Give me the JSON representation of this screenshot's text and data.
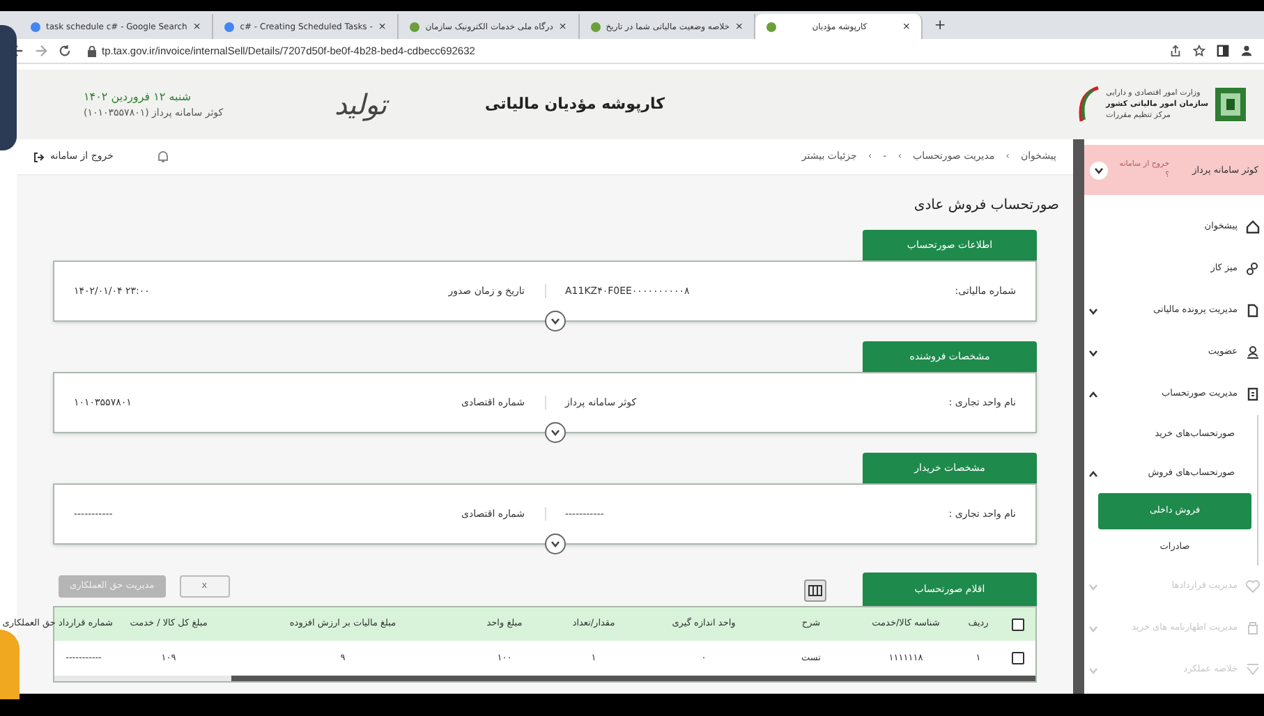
{
  "browser": {
    "tabs": [
      {
        "title": "کارپوشه مؤدیان",
        "close": "×",
        "selected": true
      },
      {
        "title": "خلاصه وضعیت مالیاتی شما در تاریخ",
        "close": "×",
        "selected": false
      },
      {
        "title": "درگاه ملی خدمات الکترونیک سازمان",
        "close": "×",
        "selected": false
      },
      {
        "title": "c# - Creating Scheduled Tasks -",
        "close": "×",
        "selected": false
      },
      {
        "title": "task schedule c# - Google Search",
        "close": "×",
        "selected": false
      }
    ],
    "new_tab": "+",
    "url": "tp.tax.gov.ir/invoice/internalSell/Details/7207d50f-be0f-4b28-bed4-cdbecc692632"
  },
  "header": {
    "date": "شنبه ۱۲ فروردین ۱۴۰۲",
    "user": "کوثر سامانه پرداز (۱۰۱۰۳۵۵۷۸۰۱)",
    "emblem_text": "تولید",
    "title": "کارپوشه مؤدیان مالیاتی",
    "org_lines": [
      "وزارت امور اقتصادی و دارایی",
      "سازمان امور مالیاتی کشور",
      "مرکز تنظیم مقررات"
    ]
  },
  "topbar": {
    "logout": "خروج از سامانه",
    "breadcrumb": [
      {
        "kind": "link",
        "text": "پیشخوان"
      },
      {
        "kind": "separator",
        "text": "›"
      },
      {
        "kind": "link",
        "text": "مدیریت صورتحساب"
      },
      {
        "kind": "separator",
        "text": "›"
      },
      {
        "kind": "link",
        "text": "-"
      },
      {
        "kind": "separator",
        "text": "›"
      },
      {
        "kind": "link",
        "text": "جزئیات بیشتر"
      }
    ]
  },
  "page_title": "صورتحساب فروش عادی",
  "sections": [
    {
      "title": "اطلاعات صورتحساب",
      "fields": [
        {
          "label": "شماره مالیاتی:",
          "value": "A11KZ۴۰F0EE۰۰۰۰۰۰۰۰۰۰۸"
        },
        {
          "label": "تاریخ و زمان صدور",
          "value": "۱۴۰۲/۰۱/۰۴  ۲۳:۰۰"
        }
      ]
    },
    {
      "title": "مشخصات فروشنده",
      "fields": [
        {
          "label": "نام واحد تجاری :",
          "value": "کوثر سامانه پرداز"
        },
        {
          "label": "شماره اقتصادی",
          "value": "۱۰۱۰۳۵۵۷۸۰۱"
        }
      ]
    },
    {
      "title": "مشخصات خریدار",
      "fields": [
        {
          "label": "نام واحد تجاری :",
          "value": "-----------"
        },
        {
          "label": "شماره اقتصادی",
          "value": "-----------"
        }
      ]
    }
  ],
  "items_section": {
    "tab": "اقلام صورتحساب",
    "buttons": [
      {
        "label": "x",
        "disabled": false
      },
      {
        "label": "مدیریت حق العملکاری",
        "disabled": true
      }
    ],
    "table": {
      "all_selected": false,
      "columns": [
        "ردیف",
        "شناسه کالا/خدمت",
        "شرح",
        "واحد اندازه گیری",
        "مقدار/تعداد",
        "مبلغ واحد",
        "مبلغ مالیات بر ارزش افزوده",
        "مبلغ کل کالا / خدمت",
        "شماره قرارداد حق العملکاری"
      ],
      "rows": [
        {
          "selected": false,
          "cells": [
            "۱",
            "۱۱۱۱۱۱۸",
            "تست",
            "۰",
            "۱",
            "۱۰۰",
            "۹",
            "۱۰۹",
            "-----------"
          ]
        }
      ]
    }
  },
  "sidebar": {
    "user": {
      "name": "کوثر سامانه پرداز",
      "action": "خروج از سامانه ؟"
    },
    "items": [
      {
        "label": "پیشخوان",
        "expandable": false,
        "disabled": false
      },
      {
        "label": "میز کار",
        "expandable": false,
        "disabled": false
      },
      {
        "label": "مدیریت پرونده مالیاتی",
        "expandable": true,
        "expanded": false,
        "disabled": false
      },
      {
        "label": "عضویت",
        "expandable": true,
        "expanded": false,
        "disabled": false
      },
      {
        "label": "مدیریت صورتحساب",
        "expandable": true,
        "expanded": true,
        "disabled": false,
        "children": [
          {
            "label": "صورتحساب‌های خرید",
            "expandable": false
          },
          {
            "label": "صورتحساب‌های فروش",
            "expandable": true,
            "expanded": true,
            "children": [
              {
                "label": "فروش داخلی",
                "selected": true
              },
              {
                "label": "صادرات",
                "selected": false
              }
            ]
          }
        ]
      },
      {
        "label": "مدیریت قراردادها",
        "expandable": true,
        "expanded": false,
        "disabled": true
      },
      {
        "label": "مدیریت اظهارنامه های خرید",
        "expandable": true,
        "expanded": false,
        "disabled": true
      },
      {
        "label": "خلاصه عملکرد",
        "expandable": true,
        "expanded": false,
        "disabled": true
      }
    ]
  }
}
